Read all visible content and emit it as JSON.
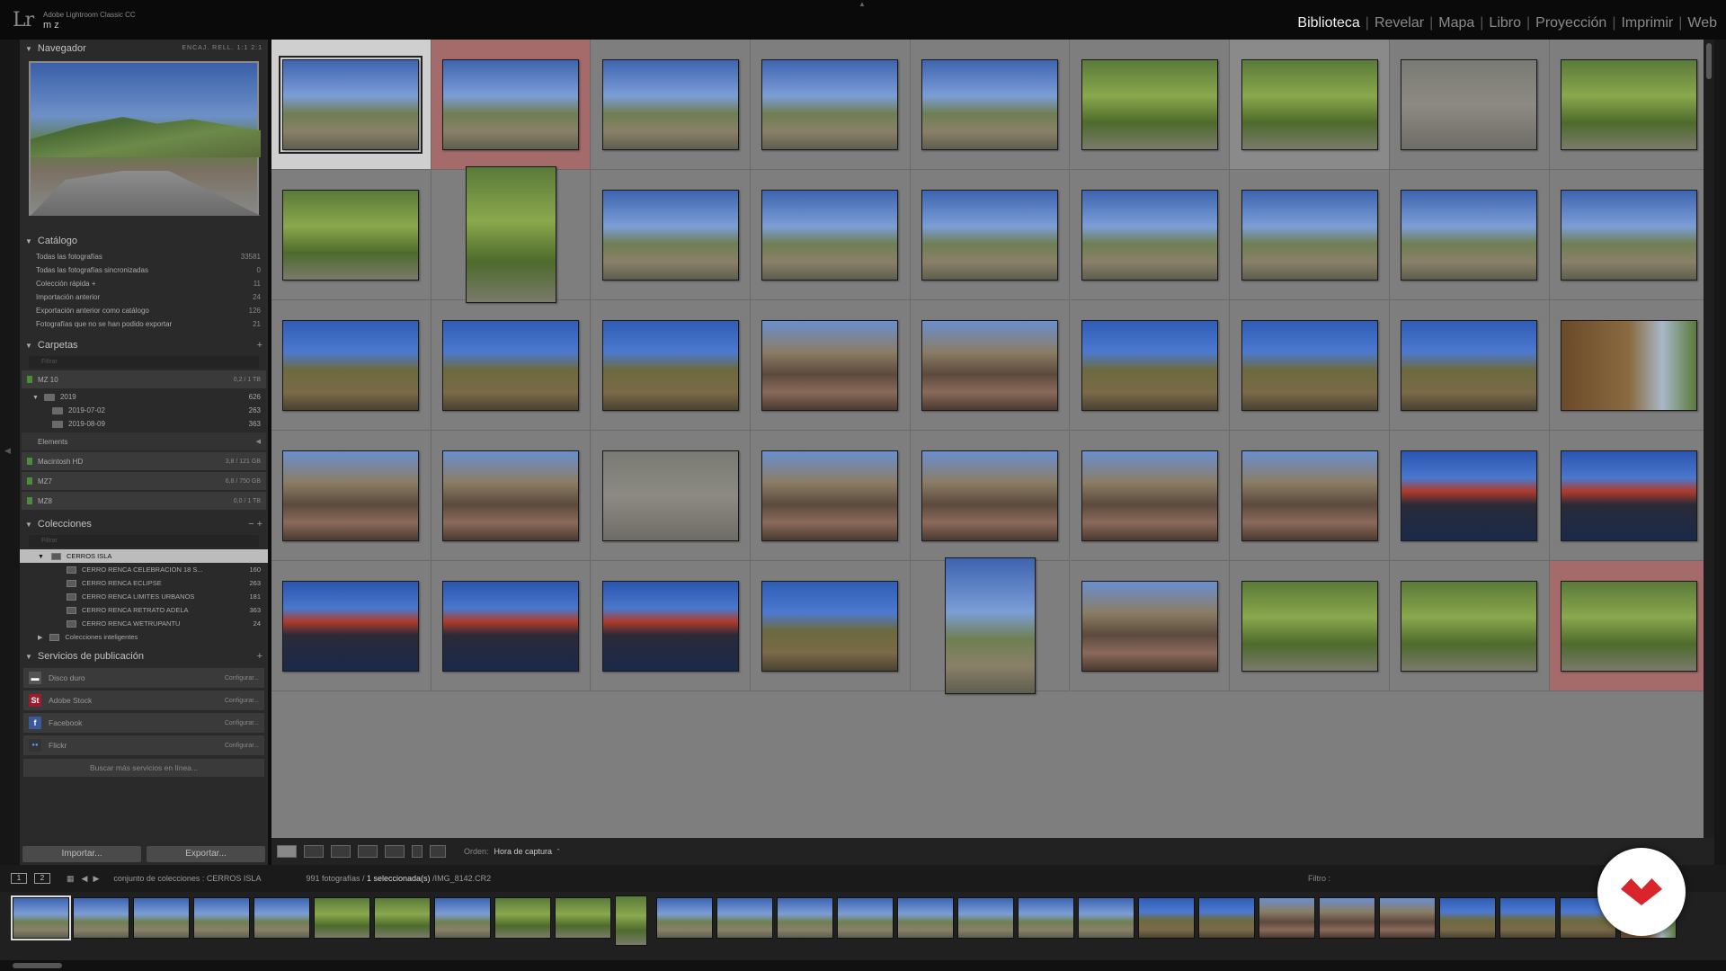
{
  "app": {
    "product": "Adobe Lightroom Classic CC",
    "catalog_user": "m z",
    "logo_text": "Lr"
  },
  "modules": [
    "Biblioteca",
    "Revelar",
    "Mapa",
    "Libro",
    "Proyección",
    "Imprimir",
    "Web"
  ],
  "active_module": "Biblioteca",
  "navigator": {
    "title": "Navegador",
    "options": "ENCAJ.  RELL.  1:1  2:1"
  },
  "catalog": {
    "title": "Catálogo",
    "items": [
      {
        "label": "Todas las fotografías",
        "count": "33581"
      },
      {
        "label": "Todas las fotografías sincronizadas",
        "count": "0"
      },
      {
        "label": "Colección rápida +",
        "count": "11"
      },
      {
        "label": "Importación anterior",
        "count": "24"
      },
      {
        "label": "Exportación anterior como catálogo",
        "count": "126"
      },
      {
        "label": "Fotografías que no se han podido exportar",
        "count": "21"
      }
    ]
  },
  "folders": {
    "title": "Carpetas",
    "search_placeholder": "Filtrar",
    "volume": {
      "label": "MZ 10",
      "info": "0,2 / 1 TB"
    },
    "tree": [
      {
        "label": "2019",
        "count": "626"
      },
      {
        "label": "2019-07-02",
        "count": "263"
      },
      {
        "label": "2019-08-09",
        "count": "363"
      }
    ],
    "elements_label": "Elements",
    "other_volumes": [
      {
        "label": "Macintosh HD",
        "info": "3,8 / 121 GB"
      },
      {
        "label": "MZ7",
        "info": "6,8 / 750 GB"
      },
      {
        "label": "MZ8",
        "info": "0,0 / 1 TB"
      }
    ]
  },
  "collections": {
    "title": "Colecciones",
    "search_placeholder": "Filtrar",
    "set": "CERROS ISLA",
    "items": [
      {
        "label": "CERRO RENCA CELEBRACION 18 S...",
        "count": "160"
      },
      {
        "label": "CERRO RENCA ECLIPSE",
        "count": "263"
      },
      {
        "label": "CERRO RENCA LIMITES URBANOS",
        "count": "181"
      },
      {
        "label": "CERRO RENCA RETRATO ADELA",
        "count": "363"
      },
      {
        "label": "CERRO RENCA WETRUPANTU",
        "count": "24"
      }
    ],
    "smart": "Colecciones inteligentes"
  },
  "publish": {
    "title": "Servicios de publicación",
    "services": [
      {
        "label": "Disco duro",
        "icon": "hard-drive-icon",
        "action": "Configurar..."
      },
      {
        "label": "Adobe Stock",
        "icon": "adobe-stock-icon",
        "action": "Configurar..."
      },
      {
        "label": "Facebook",
        "icon": "facebook-icon",
        "action": "Configurar..."
      },
      {
        "label": "Flickr",
        "icon": "flickr-icon",
        "action": "Configurar..."
      }
    ],
    "more": "Buscar más servicios en línea..."
  },
  "buttons": {
    "import": "Importar...",
    "export": "Exportar..."
  },
  "toolbar": {
    "sort_label": "Orden:",
    "sort_value": "Hora de captura"
  },
  "filmstrip_bar": {
    "page1": "1",
    "page2": "2",
    "source_prefix": "conjunto de colecciones : CERROS ISLA",
    "count": "991 fotografías /",
    "selected": "1 seleccionada(s)",
    "file": "/IMG_8142.CR2",
    "filter_label": "Filtro :"
  },
  "grid": {
    "columns": 9,
    "rows": [
      [
        "land-sky",
        "land-sky",
        "land-sky",
        "land-sky",
        "land-sky",
        "land-green",
        "land-green",
        "land-ground",
        "land-green"
      ],
      [
        "land-green",
        "port-green",
        "land-sky",
        "land-sky",
        "land-sky",
        "land-sky",
        "land-sky",
        "land-sky",
        "land-sky"
      ],
      [
        "land-dry",
        "land-dry",
        "land-dry",
        "land-crowd",
        "land-crowd",
        "land-dry",
        "land-dry",
        "land-dry",
        "land-brown"
      ],
      [
        "land-crowd",
        "land-crowd",
        "land-ground",
        "land-crowd",
        "land-crowd",
        "land-crowd",
        "land-crowd",
        "land-tramp",
        "land-tramp"
      ],
      [
        "land-tramp",
        "land-tramp",
        "land-tramp",
        "land-dry",
        "port-sky",
        "land-crowd",
        "land-green",
        "land-green",
        "land-green"
      ]
    ],
    "selected_cell": 0,
    "marked_cells": [
      1,
      44
    ]
  },
  "colors": {
    "accent_badge": "#d9242b",
    "grid_bg": "#7e7e7e",
    "marked_cell": "#a56b6b",
    "selected_cell": "#cfcfcf"
  }
}
